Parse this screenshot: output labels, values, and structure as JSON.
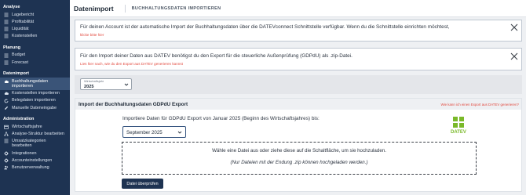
{
  "sidebar": {
    "sections": [
      {
        "heading": "Analyse",
        "items": [
          {
            "label": "Lagebericht",
            "icon": "list-icon"
          },
          {
            "label": "Profitabilität",
            "icon": "list-icon"
          },
          {
            "label": "Liquidität",
            "icon": "list-icon"
          },
          {
            "label": "Kostenstellen",
            "icon": "list-icon"
          }
        ]
      },
      {
        "heading": "Planung",
        "items": [
          {
            "label": "Budget",
            "icon": "list-icon"
          },
          {
            "label": "Forecast",
            "icon": "list-icon"
          }
        ]
      },
      {
        "heading": "Datenimport",
        "items": [
          {
            "label": "Buchhaltungsdaten importieren",
            "icon": "cloud-upload-icon",
            "active": true
          },
          {
            "label": "Kostenstellen importieren",
            "icon": "cloud-upload-icon"
          },
          {
            "label": "Belegdaten importieren",
            "icon": "refresh-icon"
          },
          {
            "label": "Manuelle Dateneingabe",
            "icon": "edit-icon"
          }
        ]
      },
      {
        "heading": "Administration",
        "items": [
          {
            "label": "Wirtschaftsjahre",
            "icon": "calendar-icon"
          },
          {
            "label": "Analyse-Struktur bearbeiten",
            "icon": "structure-icon"
          },
          {
            "label": "Umsatzkategorien bearbeiten",
            "icon": "list-icon"
          },
          {
            "label": "Integrationen",
            "icon": "gear-icon"
          },
          {
            "label": "Accounteinstellungen",
            "icon": "gear-icon"
          },
          {
            "label": "Benutzerverwaltung",
            "icon": "users-icon"
          }
        ]
      }
    ]
  },
  "header": {
    "title": "Datenimport",
    "subtitle": "BUCHHALTUNGSDATEN IMPORTIEREN"
  },
  "alerts": [
    {
      "text": "Für deinen Account ist der automatische Import der Buchhaltungsdaten über die DATEVconnect Schnittstelle verfügbar. Wenn du die Schnittstelle einrichten möchtest,",
      "link": "klicke bitte hier"
    },
    {
      "text": "Für den Import deiner Daten aus DATEV benötigst du den Export für die steuerliche Außenprüfung (GDPdU) als .zip-Datei.",
      "link": "Lies hier nach, wie du den Export aus DATEV generieren kannst"
    }
  ],
  "year_select": {
    "label": "Wirtschaftsjahr",
    "value": "2025"
  },
  "import_card": {
    "title": "Import der Buchhaltungsdaten GDPdU Export",
    "help_link": "Wie kann ich einen Export aus DATEV generieren?",
    "description": "Importiere Daten für GDPdU Export von Januar 2025 (Beginn des Wirtschaftsjahres) bis:",
    "month_select_value": "September 2025",
    "logo_text": "DATEV",
    "dropzone_text": "Wähle eine Datei aus oder ziehe diese auf die Schaltfläche, um sie hochzuladen.",
    "dropzone_hint": "(Nur Dateien mit der Endung .zip können hochgeladen werden.)",
    "button_label": "Datei überprüfen"
  },
  "colors": {
    "sidebar_bg": "#1e3352",
    "sidebar_active": "#3a5478",
    "link_red": "#e2483d",
    "datev_green": "#7ab929"
  }
}
